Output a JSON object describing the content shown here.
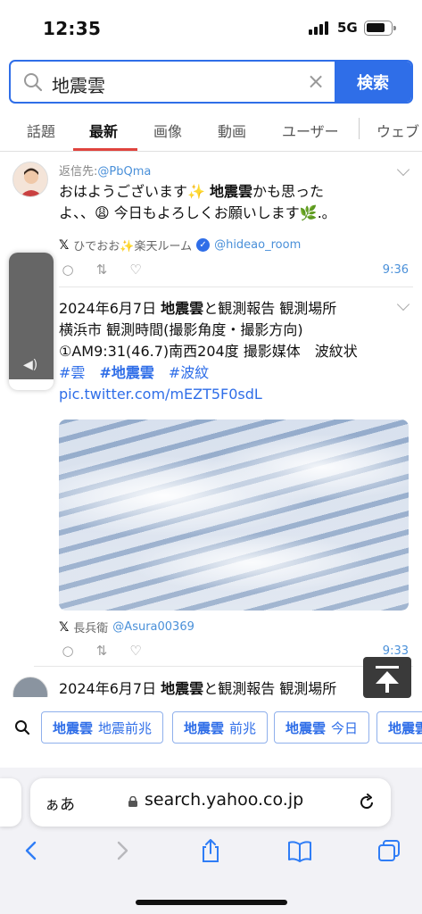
{
  "status": {
    "time": "12:35",
    "network": "5G"
  },
  "search": {
    "query": "地震雲",
    "clear_icon": "×",
    "button": "検索"
  },
  "tabs": [
    {
      "label": "話題"
    },
    {
      "label": "最新"
    },
    {
      "label": "画像"
    },
    {
      "label": "動画"
    },
    {
      "label": "ユーザー"
    },
    {
      "label": "ウェブ"
    }
  ],
  "posts": [
    {
      "reply_prefix": "返信先:",
      "reply_handle": "@PbQma",
      "line1_a": "おはようございます✨ ",
      "line1_hl": "地震雲",
      "line1_b": "かも思った",
      "line2": "よ、、😩 今日もよろしくお願いします🌿.｡",
      "author_name": "ひでおお✨楽天ルーム",
      "verified": true,
      "handle": "@hideao_room",
      "time": "9:36"
    },
    {
      "line1_a": "2024年6月7日 ",
      "line1_hl": "地震雲",
      "line1_b": "と観測報告 観測場所",
      "line2": "横浜市 観測時間(撮影角度・撮影方向)",
      "line3": "①AM9:31(46.7)南西204度 撮影媒体　波紋状",
      "tag1": "#雲",
      "tag2": "#地震雲",
      "tag3": "#波紋",
      "link": "pic.twitter.com/mEZT5F0sdL",
      "author_name": "長兵衛",
      "handle": "@Asura00369",
      "time": "9:33"
    },
    {
      "line1_a": "2024年6月7日 ",
      "line1_hl": "地震雲",
      "line1_b": "と観測報告 観測場所"
    }
  ],
  "related": [
    {
      "bold": "地震雲",
      "rest": "地震前兆"
    },
    {
      "bold": "地震雲",
      "rest": "前兆"
    },
    {
      "bold": "地震雲",
      "rest": "今日"
    },
    {
      "bold": "地震雲",
      "rest": ""
    }
  ],
  "browser": {
    "aa": "ぁあ",
    "url": "search.yahoo.co.jp"
  },
  "icons": {
    "search": "magnifier-icon",
    "reply": "reply-icon",
    "retweet": "retweet-icon",
    "like": "heart-icon",
    "x_logo": "x-logo-icon",
    "back": "back-icon",
    "forward": "forward-icon",
    "share": "share-icon",
    "bookmarks": "book-icon",
    "tabs": "tabs-icon"
  },
  "colors": {
    "accent": "#2f6ee8",
    "active_tab": "#e0443e"
  }
}
